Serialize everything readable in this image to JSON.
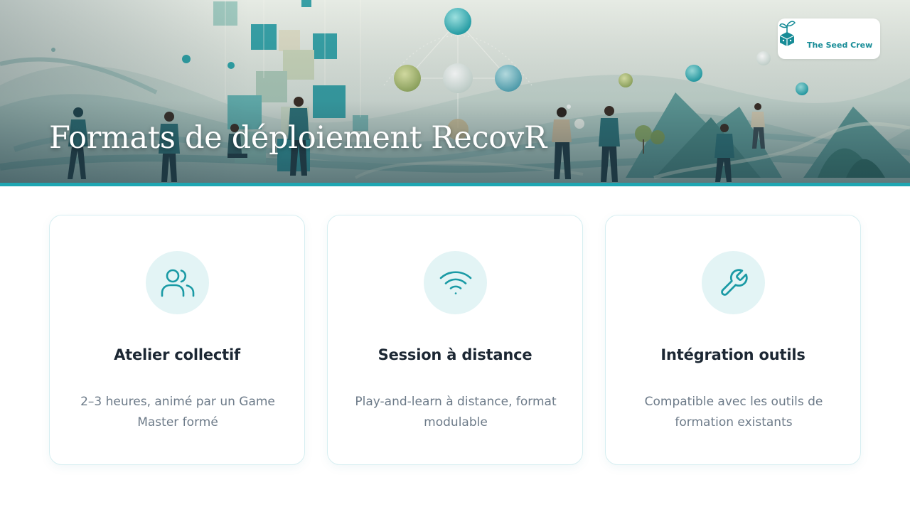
{
  "header": {
    "title": "Formats de déploiement RecovR",
    "accent_color": "#1fa6b2"
  },
  "logo": {
    "text": "The Seed Crew",
    "icon": "seedling-cube-icon",
    "color": "#178c97"
  },
  "cards": [
    {
      "icon": "users-icon",
      "title": "Atelier collectif",
      "description": "2–3 heures, animé par un Game Master formé"
    },
    {
      "icon": "wifi-icon",
      "title": "Session à distance",
      "description": "Play-and-learn à distance, format modulable"
    },
    {
      "icon": "wrench-icon",
      "title": "Intégration outils",
      "description": "Compatible avec les outils de formation existants"
    }
  ],
  "colors": {
    "icon_stroke": "#1a9aa5",
    "icon_circle": "#e3f4f5",
    "card_border": "#d6eef1",
    "title_text": "#1c2733",
    "body_text": "#6c7a88"
  }
}
